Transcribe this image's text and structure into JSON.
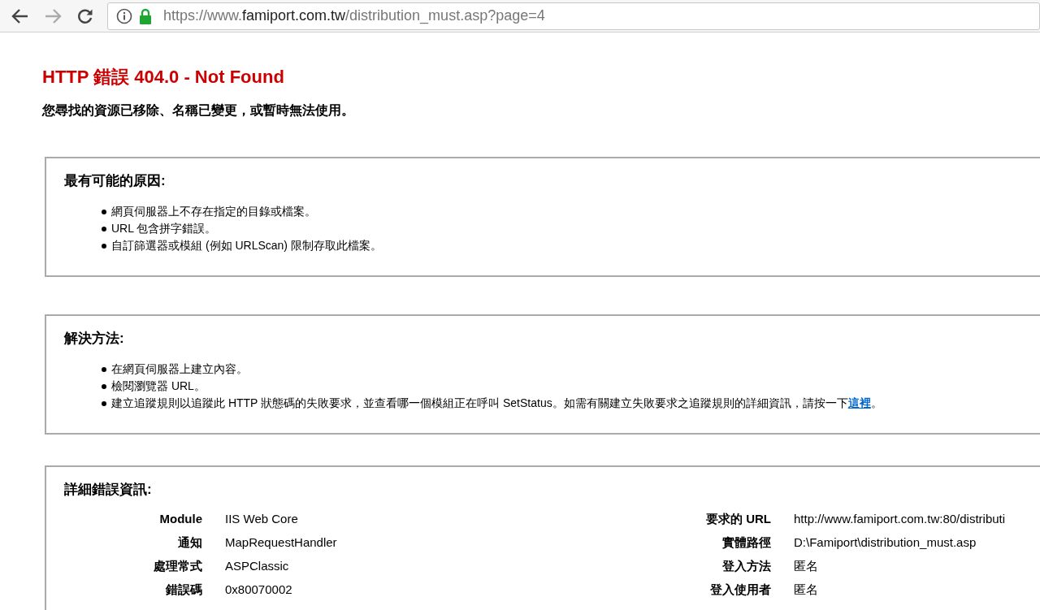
{
  "browser": {
    "nav": [
      {
        "kind": "back",
        "disabled": false
      },
      {
        "kind": "forward",
        "disabled": true
      },
      {
        "kind": "reload",
        "disabled": false
      }
    ],
    "url": {
      "prefix": "https://www.",
      "host": "famiport.com.tw",
      "path": "/distribution_must.asp?page=4"
    }
  },
  "title": "HTTP 錯誤 404.0 - Not Found",
  "subtitle": "您尋找的資源已移除、名稱已變更，或暫時無法使用。",
  "sections": [
    {
      "heading": "最有可能的原因:",
      "items": [
        {
          "text": "網頁伺服器上不存在指定的目錄或檔案。"
        },
        {
          "text": "URL 包含拼字錯誤。"
        },
        {
          "text": "自訂篩選器或模組 (例如 URLScan) 限制存取此檔案。"
        }
      ]
    },
    {
      "heading": "解決方法:",
      "items": [
        {
          "text": "在網頁伺服器上建立內容。"
        },
        {
          "text": "檢閱瀏覽器 URL。"
        },
        {
          "text": "建立追蹤規則以追蹤此 HTTP 狀態碼的失敗要求，並查看哪一個模組正在呼叫 SetStatus。如需有關建立失敗要求之追蹤規則的詳細資訊，請按一下",
          "link": "這裡",
          "suffix": "。"
        }
      ]
    }
  ],
  "details": {
    "heading": "詳細錯誤資訊:",
    "left": [
      {
        "label": "Module",
        "value": "IIS Web Core"
      },
      {
        "label": "通知",
        "value": "MapRequestHandler"
      },
      {
        "label": "處理常式",
        "value": "ASPClassic"
      },
      {
        "label": "錯誤碼",
        "value": "0x80070002"
      }
    ],
    "right": [
      {
        "label": "要求的 URL",
        "value": "http://www.famiport.com.tw:80/distributi"
      },
      {
        "label": "實體路徑",
        "value": "D:\\Famiport\\distribution_must.asp"
      },
      {
        "label": "登入方法",
        "value": "匿名"
      },
      {
        "label": "登入使用者",
        "value": "匿名"
      }
    ]
  }
}
